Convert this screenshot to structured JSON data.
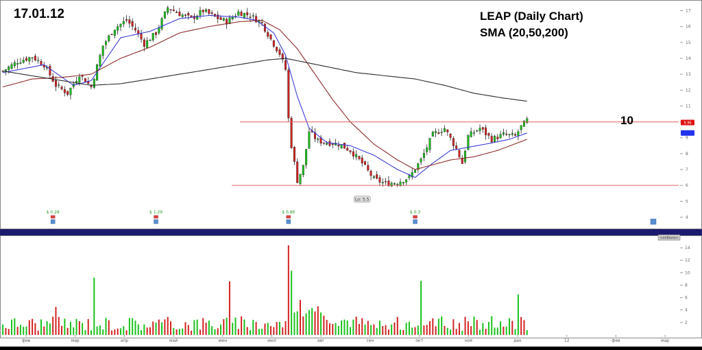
{
  "header": {
    "date_label": "17.01.12",
    "title": "LEAP (Daily Chart)",
    "subtitle": "SMA (20,50,200)",
    "level_annotation": "10"
  },
  "colors": {
    "up": "#19c219",
    "down": "#d42020",
    "sma20": "#3b3bd8",
    "sma50": "#8e2a2a",
    "sma200": "#2b2b2b",
    "hline": "#e06060",
    "last_price_badge": "#e01010",
    "sma_badge": "#2233ee",
    "separator": "#1a1a6e"
  },
  "chart_data": [
    {
      "type": "candlestick",
      "title": "LEAP (Daily Chart)",
      "subtitle": "SMA (20,50,200)",
      "ylim": [
        3.5,
        17.5
      ],
      "y_ticks": [
        4,
        5,
        6,
        7,
        8,
        9,
        10,
        11,
        12,
        13,
        14,
        15,
        16,
        17
      ],
      "x_month_labels": [
        "фев",
        "мар",
        "апр",
        "май",
        "июн",
        "июл",
        "авг",
        "сен",
        "окт",
        "ноя",
        "дек",
        "12",
        "фев",
        "мар"
      ],
      "price_path": [
        [
          0,
          13.2
        ],
        [
          5,
          13.8
        ],
        [
          10,
          14.1
        ],
        [
          14,
          13.6
        ],
        [
          18,
          12.3
        ],
        [
          22,
          11.8
        ],
        [
          26,
          13.0
        ],
        [
          30,
          12.2
        ],
        [
          34,
          14.8
        ],
        [
          38,
          15.9
        ],
        [
          42,
          16.4
        ],
        [
          45,
          15.8
        ],
        [
          48,
          14.9
        ],
        [
          52,
          15.6
        ],
        [
          56,
          17.2
        ],
        [
          60,
          16.8
        ],
        [
          64,
          16.5
        ],
        [
          68,
          17.0
        ],
        [
          72,
          16.6
        ],
        [
          76,
          16.3
        ],
        [
          80,
          16.9
        ],
        [
          84,
          16.7
        ],
        [
          88,
          16.2
        ],
        [
          91,
          15.2
        ],
        [
          94,
          14.3
        ],
        [
          96,
          13.3
        ],
        [
          97,
          10.2
        ],
        [
          98,
          8.5
        ],
        [
          100,
          6.3
        ],
        [
          102,
          7.2
        ],
        [
          104,
          9.4
        ],
        [
          107,
          8.8
        ],
        [
          110,
          8.7
        ],
        [
          114,
          8.6
        ],
        [
          118,
          8.2
        ],
        [
          122,
          7.4
        ],
        [
          126,
          6.4
        ],
        [
          130,
          6.1
        ],
        [
          134,
          6.2
        ],
        [
          138,
          6.5
        ],
        [
          142,
          7.6
        ],
        [
          146,
          9.2
        ],
        [
          150,
          9.6
        ],
        [
          154,
          8.3
        ],
        [
          156,
          7.4
        ],
        [
          158,
          9.1
        ],
        [
          162,
          9.6
        ],
        [
          166,
          8.9
        ],
        [
          170,
          9.2
        ],
        [
          174,
          9.1
        ],
        [
          176,
          9.7
        ],
        [
          178,
          10.1
        ]
      ],
      "horizontal_levels": [
        10,
        6
      ],
      "last_price": 9.96,
      "low_marker": {
        "label": "Lo: 5.5",
        "value": 5.5
      },
      "series": [
        {
          "name": "SMA 20",
          "points": [
            [
              0,
              13.1
            ],
            [
              14,
              13.6
            ],
            [
              24,
              12.3
            ],
            [
              30,
              12.6
            ],
            [
              40,
              15.3
            ],
            [
              50,
              15.7
            ],
            [
              60,
              16.5
            ],
            [
              70,
              16.7
            ],
            [
              80,
              16.6
            ],
            [
              86,
              16.4
            ],
            [
              92,
              15.6
            ],
            [
              96,
              14.2
            ],
            [
              100,
              11.6
            ],
            [
              104,
              9.6
            ],
            [
              110,
              8.7
            ],
            [
              118,
              8.5
            ],
            [
              126,
              7.9
            ],
            [
              134,
              7.0
            ],
            [
              140,
              6.5
            ],
            [
              146,
              7.4
            ],
            [
              152,
              8.2
            ],
            [
              158,
              8.4
            ],
            [
              164,
              8.6
            ],
            [
              172,
              8.9
            ],
            [
              178,
              9.3
            ]
          ]
        },
        {
          "name": "SMA 50",
          "points": [
            [
              0,
              12.2
            ],
            [
              10,
              12.7
            ],
            [
              20,
              12.8
            ],
            [
              30,
              13.0
            ],
            [
              40,
              14.0
            ],
            [
              50,
              14.7
            ],
            [
              60,
              15.6
            ],
            [
              70,
              16.0
            ],
            [
              80,
              16.3
            ],
            [
              88,
              16.4
            ],
            [
              94,
              15.8
            ],
            [
              100,
              14.6
            ],
            [
              106,
              13.0
            ],
            [
              112,
              11.4
            ],
            [
              118,
              10.0
            ],
            [
              126,
              8.6
            ],
            [
              134,
              7.6
            ],
            [
              140,
              7.0
            ],
            [
              146,
              7.3
            ],
            [
              152,
              7.6
            ],
            [
              160,
              7.8
            ],
            [
              168,
              8.2
            ],
            [
              178,
              8.9
            ]
          ]
        },
        {
          "name": "SMA 200",
          "points": [
            [
              0,
              13.2
            ],
            [
              20,
              12.6
            ],
            [
              30,
              12.3
            ],
            [
              40,
              12.4
            ],
            [
              50,
              12.7
            ],
            [
              60,
              13.0
            ],
            [
              70,
              13.3
            ],
            [
              80,
              13.6
            ],
            [
              90,
              13.9
            ],
            [
              96,
              14.0
            ],
            [
              104,
              13.7
            ],
            [
              112,
              13.4
            ],
            [
              120,
              13.1
            ],
            [
              130,
              12.9
            ],
            [
              140,
              12.7
            ],
            [
              150,
              12.3
            ],
            [
              160,
              11.8
            ],
            [
              170,
              11.5
            ],
            [
              178,
              11.3
            ]
          ]
        }
      ],
      "dividends": [
        {
          "label": "$ 0.28",
          "at": 17
        },
        {
          "label": "$ 1.29",
          "at": 52
        },
        {
          "label": "$ 0.86",
          "at": 97
        },
        {
          "label": "$ 0.3",
          "at": 140
        }
      ],
      "right_tab_label": "millions"
    },
    {
      "type": "bar",
      "title": "",
      "ylim": [
        0,
        15
      ],
      "y_ticks": [
        2,
        4,
        6,
        8,
        10,
        12,
        14
      ],
      "spike_bars": [
        {
          "x": 18,
          "value": 4.5,
          "color": "down"
        },
        {
          "x": 31,
          "value": 9.2,
          "color": "up"
        },
        {
          "x": 77,
          "value": 8.6,
          "color": "down"
        },
        {
          "x": 97,
          "value": 14.4,
          "color": "down"
        },
        {
          "x": 98,
          "value": 10.3,
          "color": "up"
        },
        {
          "x": 142,
          "value": 8.7,
          "color": "up"
        },
        {
          "x": 175,
          "value": 6.5,
          "color": "up"
        }
      ]
    }
  ]
}
